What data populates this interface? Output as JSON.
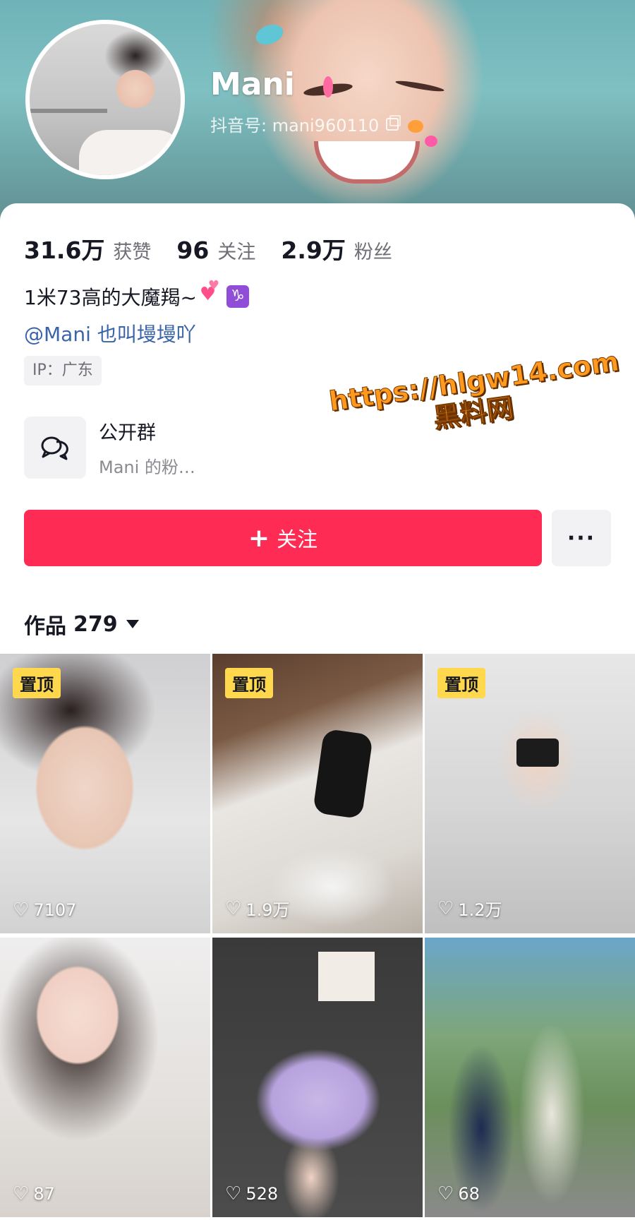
{
  "profile": {
    "name": "Mani",
    "douyin_id": "抖音号: mani960110",
    "stats": [
      {
        "value": "31.6万",
        "label": "获赞"
      },
      {
        "value": "96",
        "label": "关注"
      },
      {
        "value": "2.9万",
        "label": "粉丝"
      }
    ],
    "bio_line": "1米73高的大魔羯~",
    "bio_emoji_icons": [
      "two-hearts-icon",
      "capricorn-icon"
    ],
    "mention": "@Mani 也叫墁墁吖",
    "ip": "IP：广东"
  },
  "group": {
    "title": "公开群",
    "subtitle": "Mani 的粉…",
    "icon": "chat-bubbles-icon"
  },
  "actions": {
    "follow_label": "关注",
    "follow_icon": "plus-icon",
    "more_label": "···"
  },
  "works": {
    "label": "作品",
    "count": "279"
  },
  "watermark": {
    "url": "https://hlgw14.com",
    "name": "黑料网"
  },
  "grid": [
    {
      "pinned": "置顶",
      "likes": "7107"
    },
    {
      "pinned": "置顶",
      "likes": "1.9万"
    },
    {
      "pinned": "置顶",
      "likes": "1.2万"
    },
    {
      "pinned": "",
      "likes": "87"
    },
    {
      "pinned": "",
      "likes": "528"
    },
    {
      "pinned": "",
      "likes": "68"
    }
  ],
  "colors": {
    "accent": "#fe2c55",
    "pin_badge": "#ffd84d",
    "mention": "#3a64a8"
  }
}
